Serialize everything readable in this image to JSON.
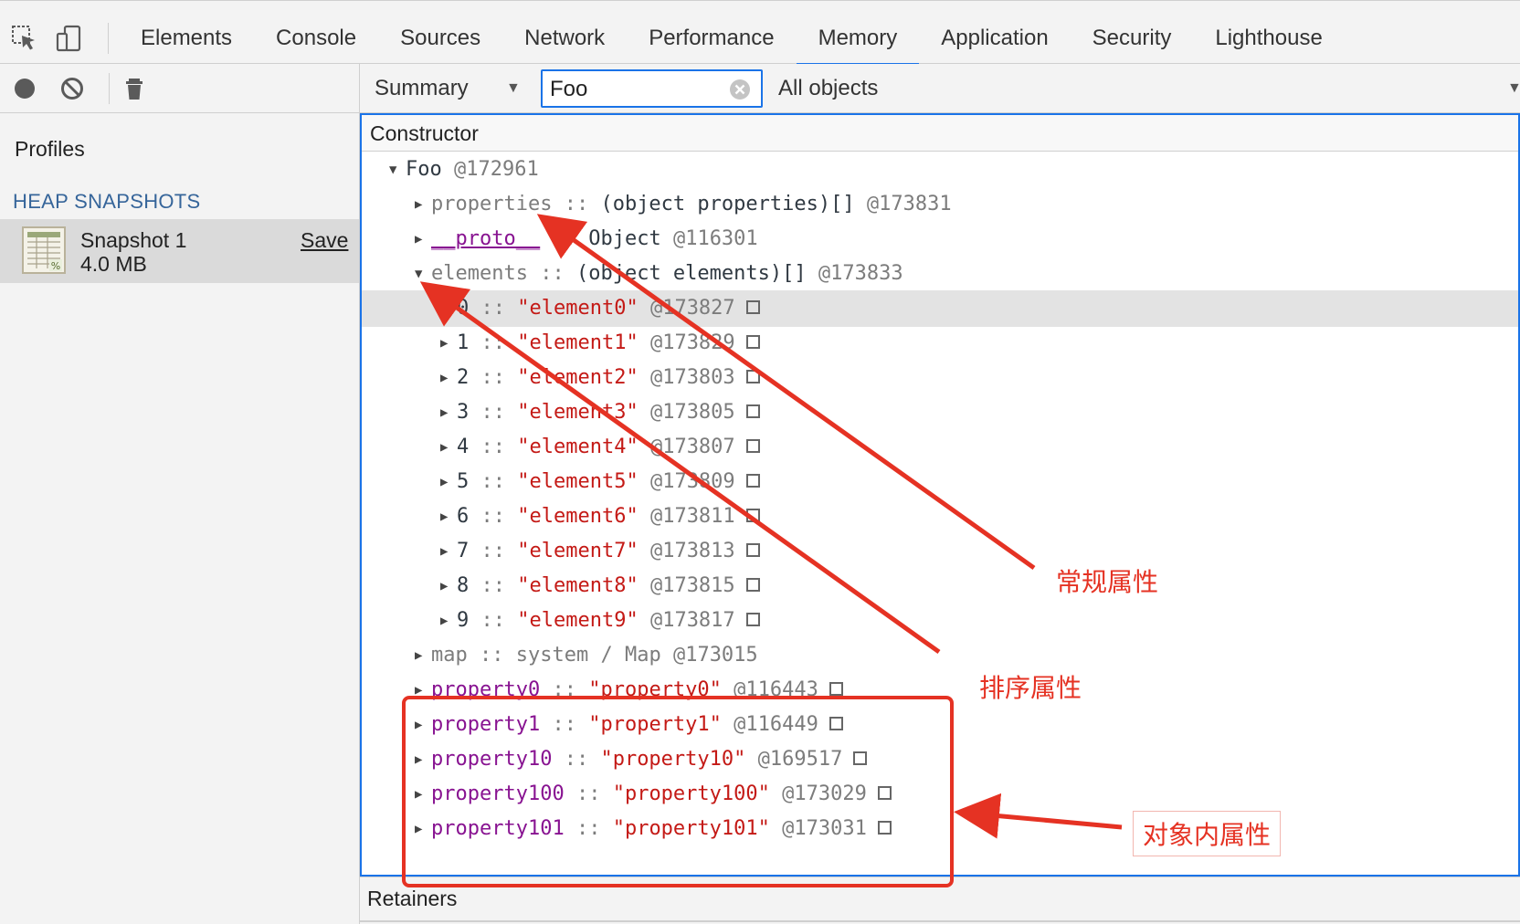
{
  "tabs": [
    "Elements",
    "Console",
    "Sources",
    "Network",
    "Performance",
    "Memory",
    "Application",
    "Security",
    "Lighthouse"
  ],
  "active_tab": "Memory",
  "toolbar": {
    "view_select": "Summary",
    "filter_value": "Foo",
    "class_filter": "All objects"
  },
  "sidebar": {
    "profiles_label": "Profiles",
    "section_label": "HEAP SNAPSHOTS",
    "snapshot": {
      "name": "Snapshot 1",
      "size": "4.0 MB",
      "save_label": "Save"
    }
  },
  "grid": {
    "header": "Constructor",
    "root": {
      "name": "Foo",
      "id": "@172961"
    },
    "rows": [
      {
        "key": "properties",
        "sep": "::",
        "value": "(object properties)[]",
        "id": "@173831",
        "key_style": "dim",
        "val_style": "plain"
      },
      {
        "key": "__proto__",
        "sep": "::",
        "value": "Object",
        "id": "@116301",
        "key_style": "proto",
        "val_style": "plain"
      },
      {
        "key": "elements",
        "sep": "::",
        "value": "(object elements)[]",
        "id": "@173833",
        "key_style": "dim",
        "val_style": "plain"
      }
    ],
    "elements": [
      {
        "index": "0",
        "value": "\"element0\"",
        "id": "@173827"
      },
      {
        "index": "1",
        "value": "\"element1\"",
        "id": "@173829"
      },
      {
        "index": "2",
        "value": "\"element2\"",
        "id": "@173803"
      },
      {
        "index": "3",
        "value": "\"element3\"",
        "id": "@173805"
      },
      {
        "index": "4",
        "value": "\"element4\"",
        "id": "@173807"
      },
      {
        "index": "5",
        "value": "\"element5\"",
        "id": "@173809"
      },
      {
        "index": "6",
        "value": "\"element6\"",
        "id": "@173811"
      },
      {
        "index": "7",
        "value": "\"element7\"",
        "id": "@173813"
      },
      {
        "index": "8",
        "value": "\"element8\"",
        "id": "@173815"
      },
      {
        "index": "9",
        "value": "\"element9\"",
        "id": "@173817"
      }
    ],
    "map_row": {
      "key": "map",
      "sep": "::",
      "value": "system / Map",
      "id": "@173015"
    },
    "properties": [
      {
        "key": "property0",
        "value": "\"property0\"",
        "id": "@116443"
      },
      {
        "key": "property1",
        "value": "\"property1\"",
        "id": "@116449"
      },
      {
        "key": "property10",
        "value": "\"property10\"",
        "id": "@169517"
      },
      {
        "key": "property100",
        "value": "\"property100\"",
        "id": "@173029"
      },
      {
        "key": "property101",
        "value": "\"property101\"",
        "id": "@173031"
      }
    ]
  },
  "retainers_label": "Retainers",
  "annotations": {
    "regular": "常规属性",
    "sorted": "排序属性",
    "in_object": "对象内属性",
    "color": "#e53223"
  },
  "colors": {
    "accent": "#1a73e8",
    "string": "#c41a16",
    "property_key": "#881391"
  }
}
